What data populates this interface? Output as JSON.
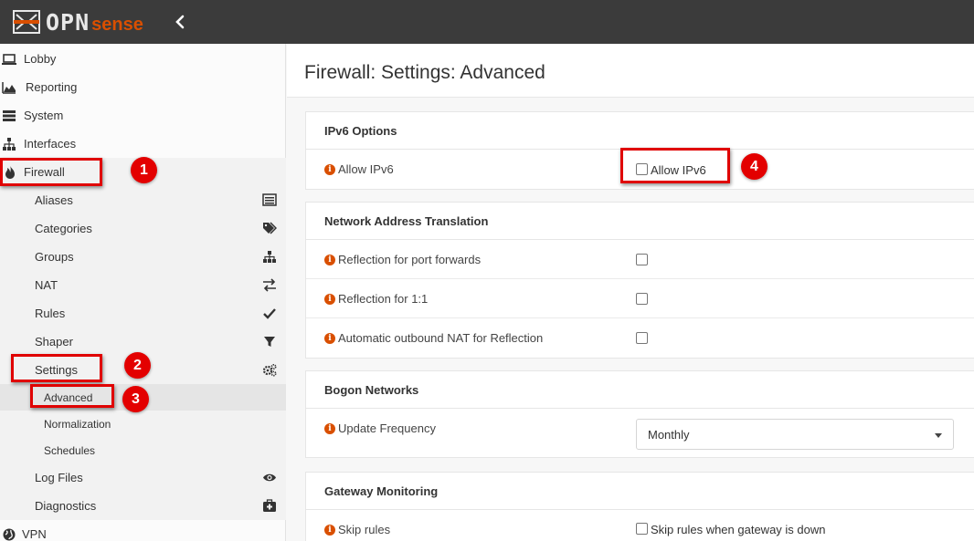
{
  "brand": {
    "opn": "OPN",
    "sense": "sense"
  },
  "sidebar": {
    "top_items": [
      {
        "label": "Lobby",
        "icon": "laptop-icon"
      },
      {
        "label": "Reporting",
        "icon": "area-chart-icon"
      },
      {
        "label": "System",
        "icon": "server-icon"
      },
      {
        "label": "Interfaces",
        "icon": "sitemap-icon"
      },
      {
        "label": "Firewall",
        "icon": "fire-icon"
      }
    ],
    "firewall_items": [
      {
        "label": "Aliases",
        "icon": "list-alt-icon"
      },
      {
        "label": "Categories",
        "icon": "tags-icon"
      },
      {
        "label": "Groups",
        "icon": "sitemap-icon"
      },
      {
        "label": "NAT",
        "icon": "exchange-icon"
      },
      {
        "label": "Rules",
        "icon": "check-icon"
      },
      {
        "label": "Shaper",
        "icon": "filter-icon"
      },
      {
        "label": "Settings",
        "icon": "cogs-icon"
      }
    ],
    "settings_items": [
      {
        "label": "Advanced"
      },
      {
        "label": "Normalization"
      },
      {
        "label": "Schedules"
      }
    ],
    "bottom_firewall_items": [
      {
        "label": "Log Files",
        "icon": "eye-icon"
      },
      {
        "label": "Diagnostics",
        "icon": "medkit-icon"
      }
    ],
    "vpn": {
      "label": "VPN",
      "icon": "globe-icon"
    }
  },
  "page": {
    "title": "Firewall: Settings: Advanced"
  },
  "sections": {
    "ipv6": {
      "title": "IPv6 Options",
      "allow_label": "Allow IPv6",
      "allow_checkbox_label": "Allow IPv6"
    },
    "nat": {
      "title": "Network Address Translation",
      "reflection_port": "Reflection for port forwards",
      "reflection_1to1": "Reflection for 1:1",
      "auto_outbound": "Automatic outbound NAT for Reflection"
    },
    "bogon": {
      "title": "Bogon Networks",
      "update_label": "Update Frequency",
      "update_value": "Monthly"
    },
    "gateway": {
      "title": "Gateway Monitoring",
      "skip_label": "Skip rules",
      "skip_checkbox_label": "Skip rules when gateway is down"
    }
  },
  "annotations": [
    "1",
    "2",
    "3",
    "4"
  ],
  "colors": {
    "accent": "#d94f00",
    "topbar": "#3b3b3b",
    "annotation": "#e30000"
  }
}
